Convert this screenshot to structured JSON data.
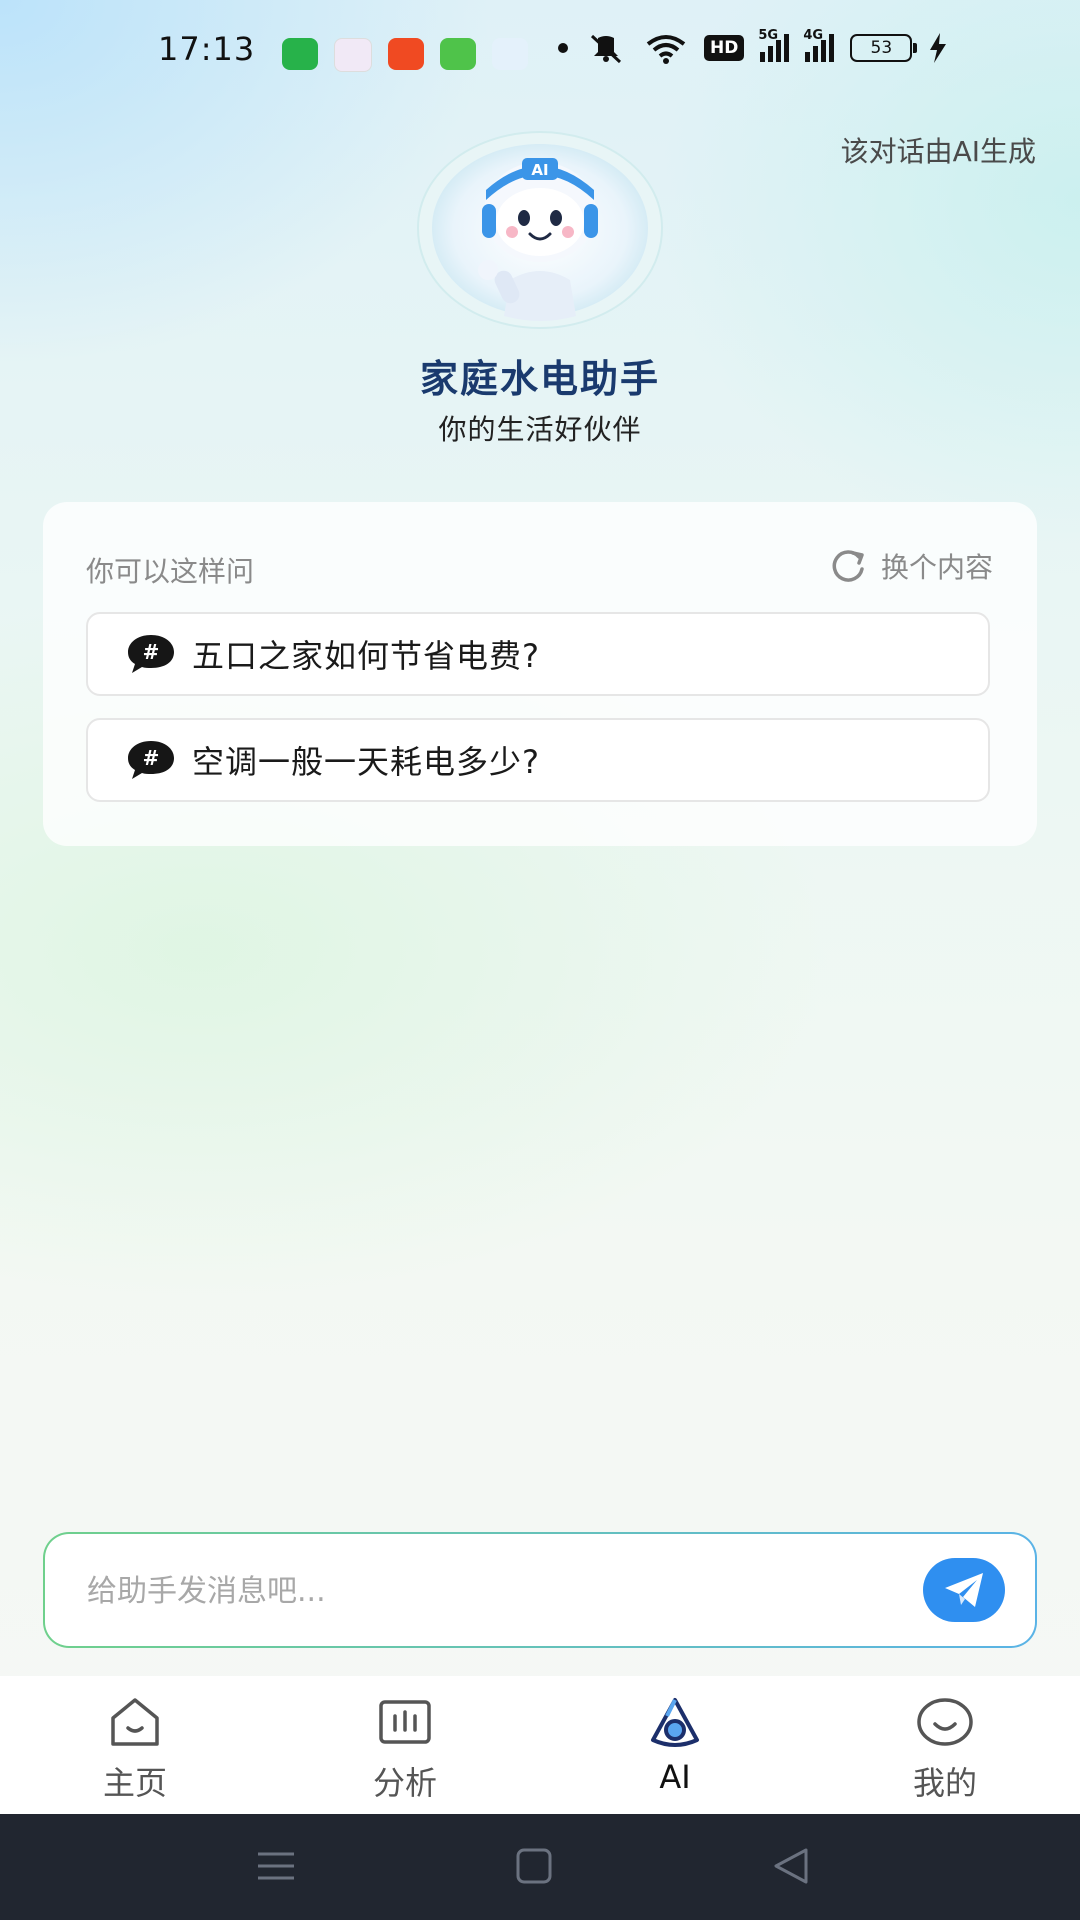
{
  "status_bar": {
    "time": "17:13",
    "battery": "53",
    "network_5g": "5G",
    "network_4g": "4G",
    "hd": "HD"
  },
  "header": {
    "disclaimer": "该对话由AI生成",
    "assistant_name": "家庭水电助手",
    "tagline": "你的生活好伙伴",
    "avatar_badge": "AI"
  },
  "suggestions": {
    "hint": "你可以这样问",
    "refresh_label": "换个内容",
    "items": [
      {
        "text": "五口之家如何节省电费?"
      },
      {
        "text": "空调一般一天耗电多少?"
      }
    ]
  },
  "input": {
    "placeholder": "给助手发消息吧...",
    "value": ""
  },
  "tabs": [
    {
      "label": "主页",
      "icon": "home-icon"
    },
    {
      "label": "分析",
      "icon": "chart-icon"
    },
    {
      "label": "AI",
      "icon": "ai-icon",
      "active": true
    },
    {
      "label": "我的",
      "icon": "profile-icon"
    }
  ],
  "colors": {
    "title": "#1a3a6e",
    "accent": "#2f8ff0",
    "border_gradient_start": "#6fd08c",
    "border_gradient_end": "#5ab3e6"
  }
}
